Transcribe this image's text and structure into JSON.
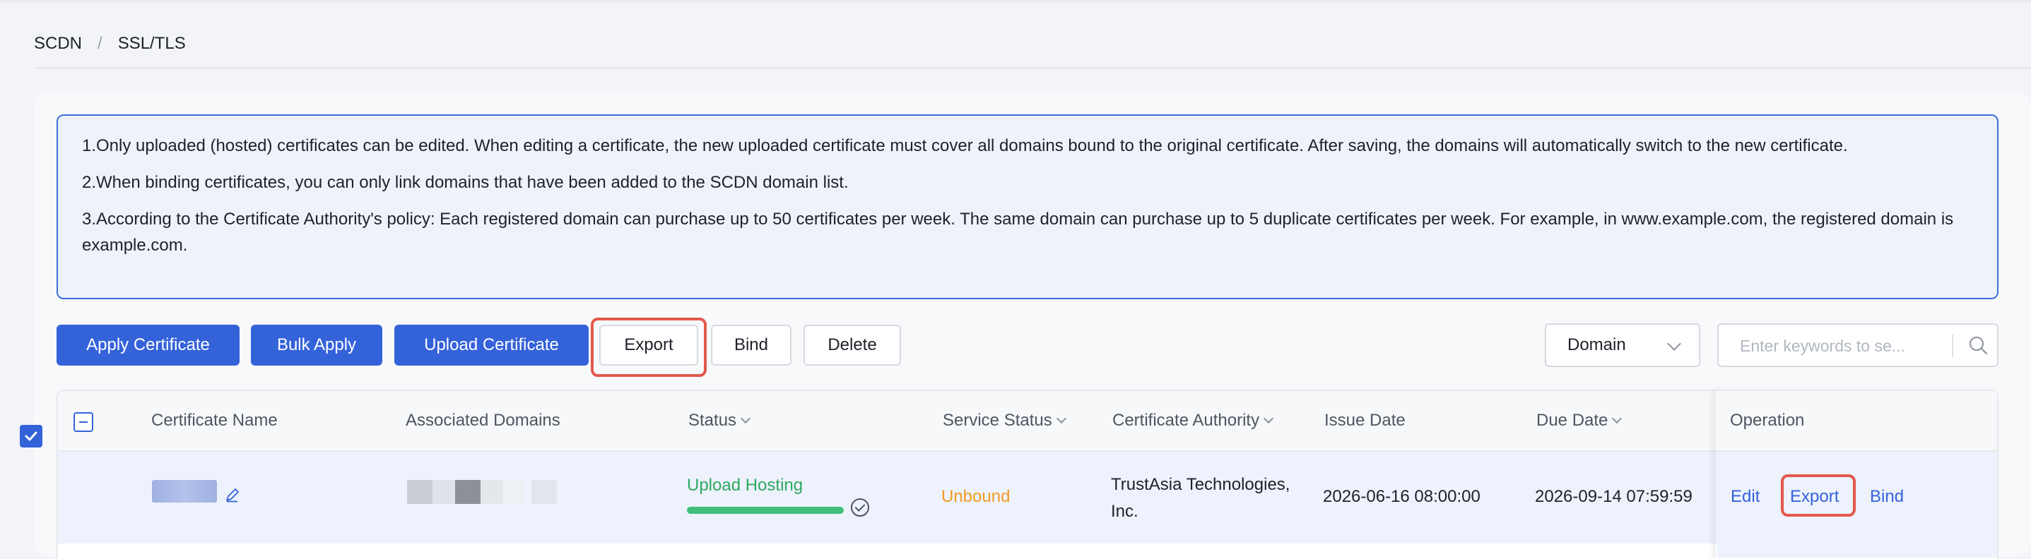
{
  "breadcrumb": {
    "root": "SCDN",
    "separator": "/",
    "current": "SSL/TLS"
  },
  "notice": {
    "line1": "1.Only uploaded (hosted) certificates can be edited. When editing a certificate, the new uploaded certificate must cover all domains bound to the original certificate. After saving, the domains will automatically switch to the new certificate.",
    "line2": "2.When binding certificates, you can only link domains that have been added to the SCDN domain list.",
    "line3": "3.According to the Certificate Authority's policy: Each registered domain can purchase up to 50 certificates per week. The same domain can purchase up to 5 duplicate certificates per week. For example, in www.example.com, the registered domain is example.com."
  },
  "toolbar": {
    "apply": "Apply Certificate",
    "bulk_apply": "Bulk Apply",
    "upload": "Upload Certificate",
    "export": "Export",
    "bind": "Bind",
    "delete": "Delete"
  },
  "filter": {
    "field": "Domain",
    "search_placeholder": "Enter keywords to se..."
  },
  "table": {
    "headers": {
      "name": "Certificate Name",
      "domains": "Associated Domains",
      "status": "Status",
      "service_status": "Service Status",
      "authority": "Certificate Authority",
      "issue_date": "Issue Date",
      "due_date": "Due Date",
      "operation": "Operation"
    },
    "rows": [
      {
        "status": "Upload Hosting",
        "service_status": "Unbound",
        "authority": "TrustAsia Technologies, Inc.",
        "issue_date": "2026-06-16 08:00:00",
        "due_date": "2026-09-14 07:59:59",
        "actions": {
          "edit": "Edit",
          "export": "Export",
          "bind": "Bind"
        },
        "progress": 1.0
      }
    ]
  },
  "colors": {
    "primary": "#3462d9",
    "highlight": "#e3584d",
    "success": "#2fa862",
    "warning": "#f29b21"
  }
}
